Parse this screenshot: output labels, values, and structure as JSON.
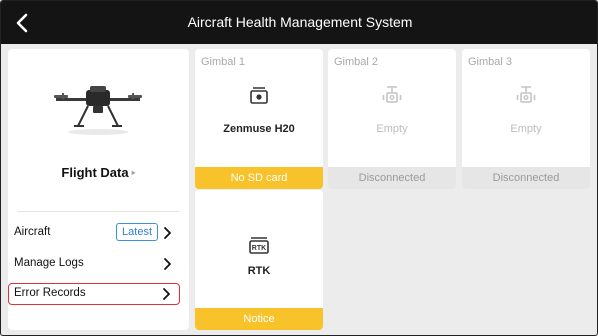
{
  "header": {
    "title": "Aircraft Health Management System",
    "back_icon": "chevron-left-icon"
  },
  "left_panel": {
    "flight_data_label": "Flight Data",
    "flight_data_caret": "▸",
    "menu": [
      {
        "label": "Aircraft",
        "badge": "Latest"
      },
      {
        "label": "Manage Logs"
      },
      {
        "label": "Error Records"
      }
    ]
  },
  "modules": [
    {
      "title": "Gimbal 1",
      "name": "Zenmuse H20",
      "status": "No SD card",
      "status_type": "warning",
      "icon": "camera-icon"
    },
    {
      "title": "Gimbal 2",
      "name": "Empty",
      "status": "Disconnected",
      "status_type": "inactive",
      "icon": "gimbal-mount-icon"
    },
    {
      "title": "Gimbal 3",
      "name": "Empty",
      "status": "Disconnected",
      "status_type": "inactive",
      "icon": "gimbal-mount-icon"
    },
    {
      "title": "",
      "name": "RTK",
      "status": "Notice",
      "status_type": "warning",
      "icon": "rtk-icon"
    }
  ],
  "colors": {
    "warning": "#f7c22a",
    "accent": "#3f8fe8",
    "highlight": "#e0303a",
    "topbar": "#141414"
  }
}
